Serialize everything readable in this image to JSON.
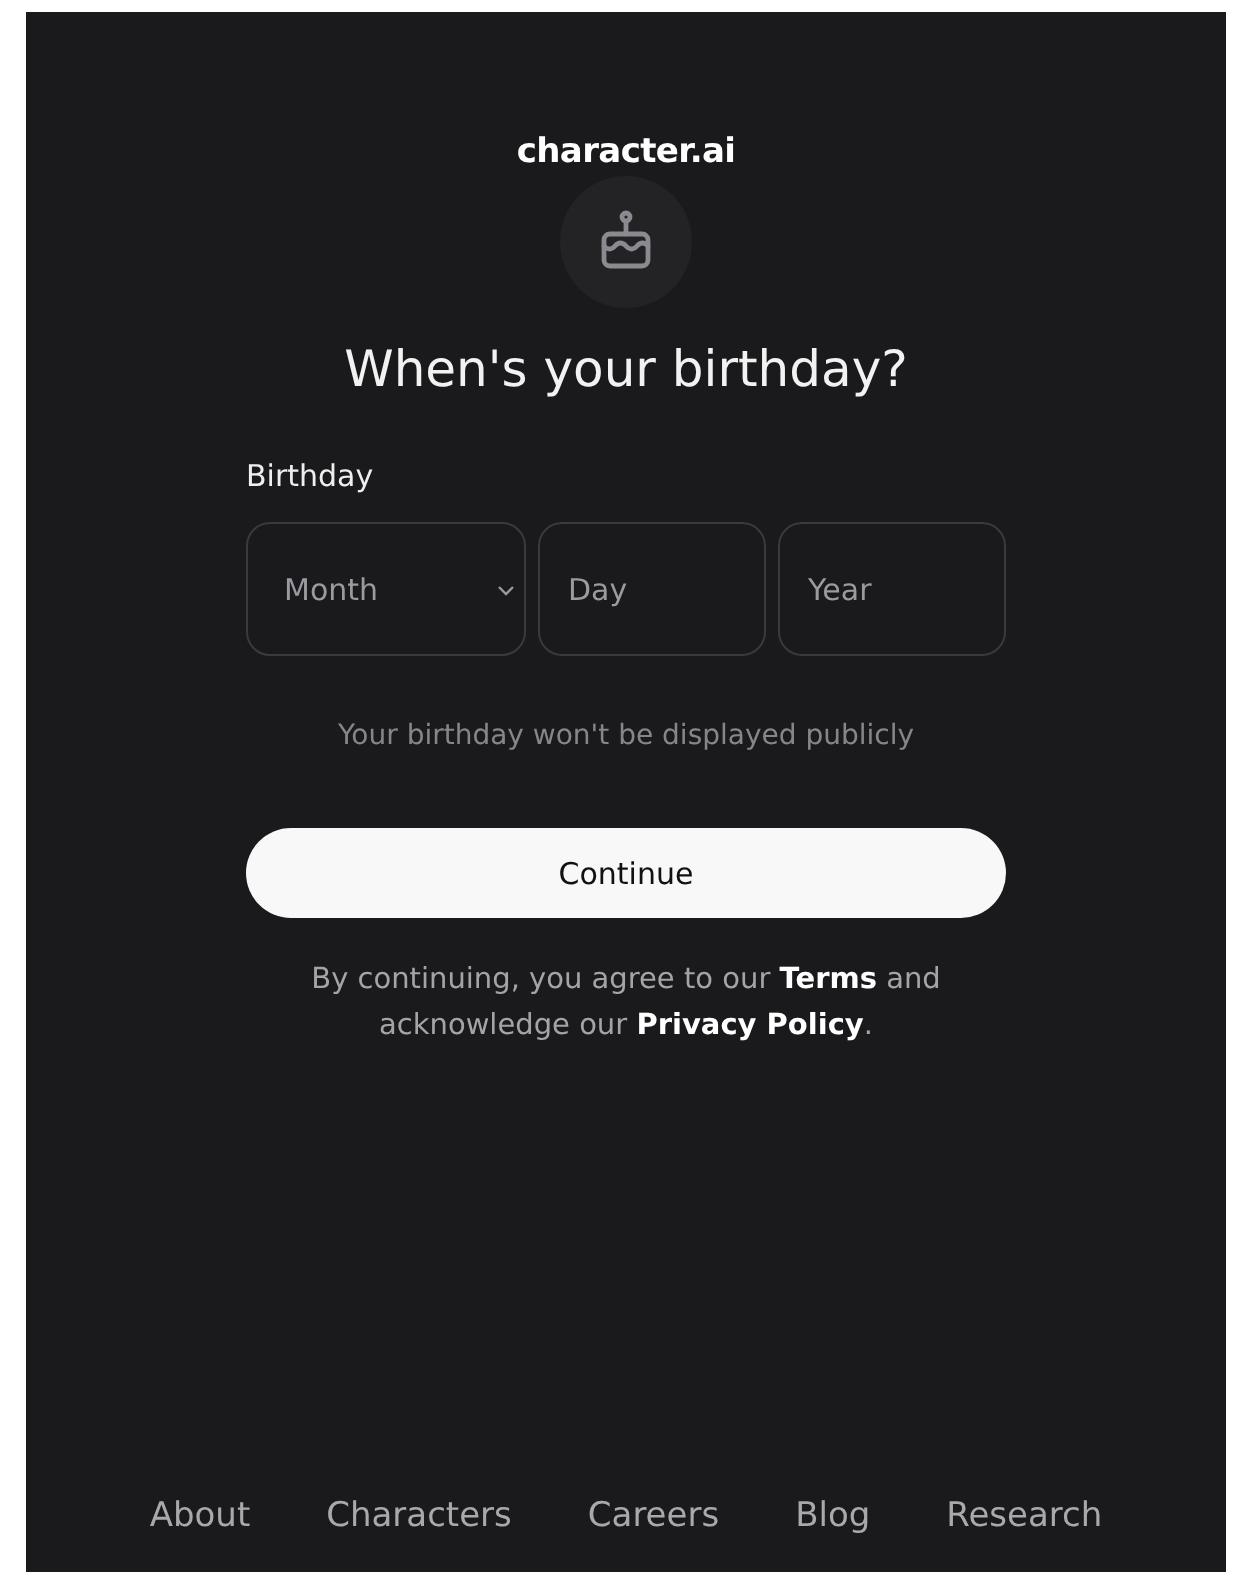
{
  "logo": "character.ai",
  "title": "When's your birthday?",
  "birthday_label": "Birthday",
  "fields": [
    {
      "kind": "select",
      "placeholder": "Month"
    },
    {
      "kind": "input",
      "placeholder": "Day"
    },
    {
      "kind": "input",
      "placeholder": "Year"
    }
  ],
  "note": "Your birthday won't be displayed publicly",
  "continue_button": "Continue",
  "legal": {
    "before": "By continuing, you agree to our ",
    "terms_link": "Terms",
    "middle": " and acknowledge our ",
    "privacy_link": "Privacy Policy",
    "after": "."
  },
  "footer_links": [
    "About",
    "Characters",
    "Careers",
    "Blog",
    "Research"
  ]
}
